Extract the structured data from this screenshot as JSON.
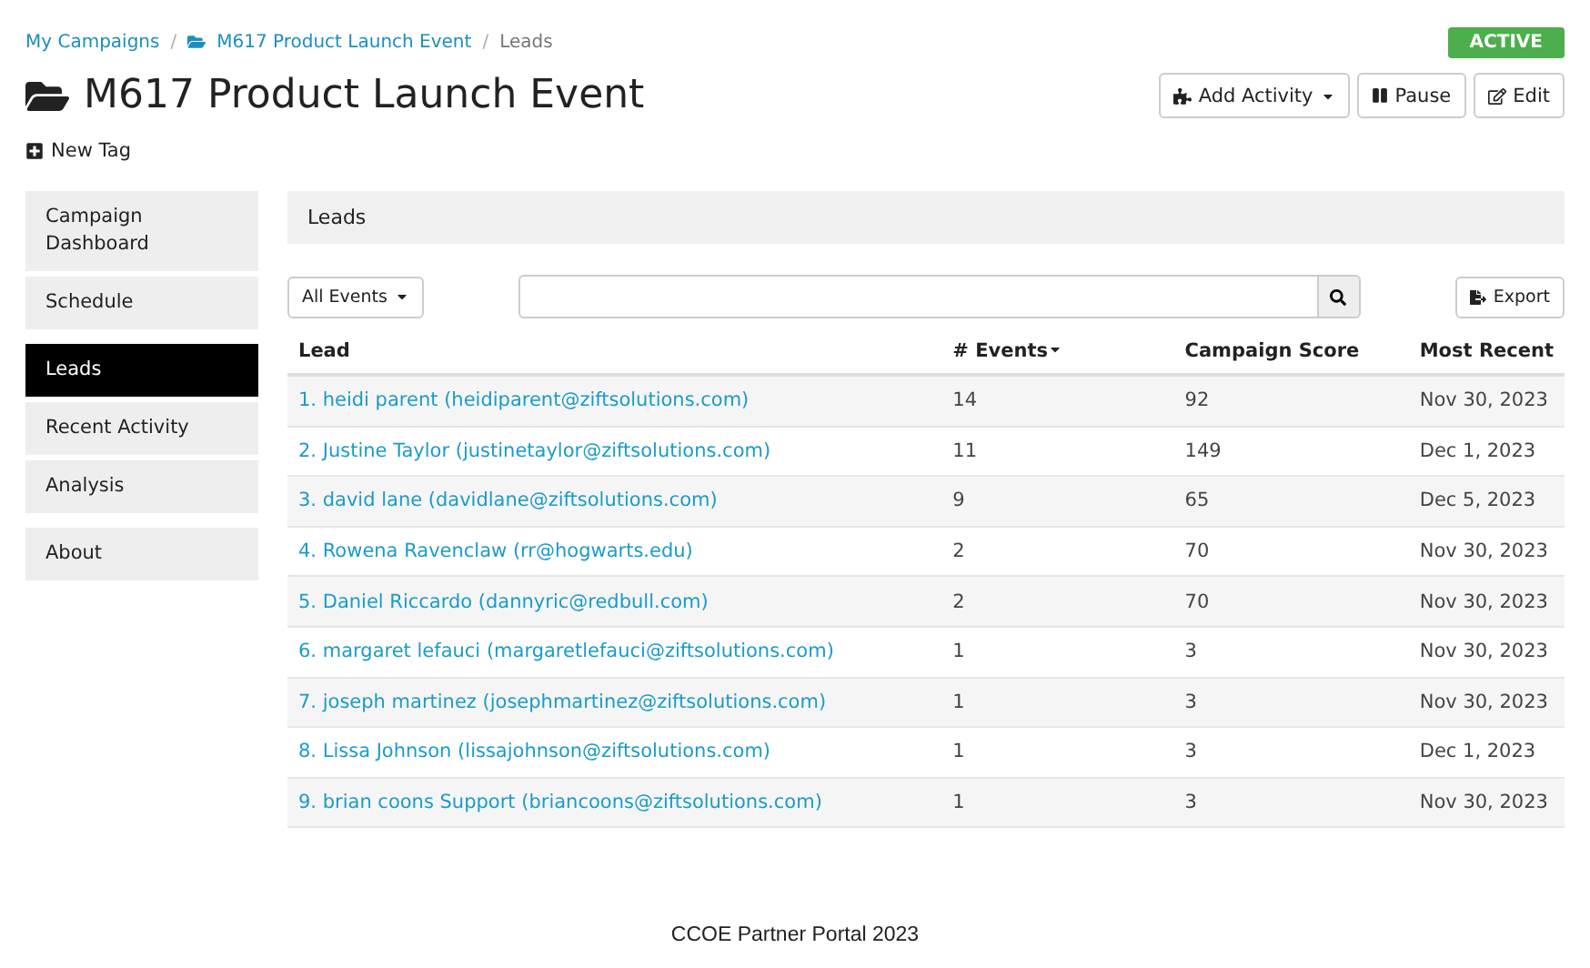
{
  "breadcrumb_separator": "/",
  "breadcrumbs": [
    {
      "label": "My Campaigns",
      "kind": "link"
    },
    {
      "label": "M617 Product Launch Event",
      "kind": "folder-link"
    },
    {
      "label": "Leads",
      "kind": "current"
    }
  ],
  "status_badge": "ACTIVE",
  "title": "M617 Product Launch Event",
  "actions": [
    {
      "label": "Add Activity",
      "kind": "dropdown"
    },
    {
      "label": "Pause",
      "kind": "pause"
    },
    {
      "label": "Edit",
      "kind": "edit"
    }
  ],
  "new_tag": "New Tag",
  "sidebar": {
    "groups": [
      [
        {
          "label": "Campaign Dashboard",
          "selected": false
        },
        {
          "label": "Schedule",
          "selected": false
        }
      ],
      [
        {
          "label": "Leads",
          "selected": true
        },
        {
          "label": "Recent Activity",
          "selected": false
        },
        {
          "label": "Analysis",
          "selected": false
        }
      ],
      [
        {
          "label": "About",
          "selected": false
        }
      ]
    ]
  },
  "panel_title": "Leads",
  "filter": "All Events",
  "export": "Export",
  "table": {
    "columns": [
      {
        "label": "Lead",
        "sorted": false
      },
      {
        "label": "# Events",
        "sorted": true
      },
      {
        "label": "Campaign Score",
        "sorted": false
      },
      {
        "label": "Most Recent",
        "sorted": false
      }
    ],
    "rows": [
      [
        "1. heidi parent (heidiparent@ziftsolutions.com)",
        "14",
        "92",
        "Nov 30, 2023"
      ],
      [
        "2. Justine Taylor (justinetaylor@ziftsolutions.com)",
        "11",
        "149",
        "Dec 1, 2023"
      ],
      [
        "3. david lane (davidlane@ziftsolutions.com)",
        "9",
        "65",
        "Dec 5, 2023"
      ],
      [
        "4. Rowena Ravenclaw (rr@hogwarts.edu)",
        "2",
        "70",
        "Nov 30, 2023"
      ],
      [
        "5. Daniel Riccardo (dannyric@redbull.com)",
        "2",
        "70",
        "Nov 30, 2023"
      ],
      [
        "6. margaret lefauci (margaretlefauci@ziftsolutions.com)",
        "1",
        "3",
        "Nov 30, 2023"
      ],
      [
        "7. joseph martinez (josephmartinez@ziftsolutions.com)",
        "1",
        "3",
        "Nov 30, 2023"
      ],
      [
        "8. Lissa Johnson (lissajohnson@ziftsolutions.com)",
        "1",
        "3",
        "Dec 1, 2023"
      ],
      [
        "9. brian coons Support (briancoons@ziftsolutions.com)",
        "1",
        "3",
        "Nov 30, 2023"
      ]
    ]
  },
  "footer": "CCOE Partner Portal 2023"
}
